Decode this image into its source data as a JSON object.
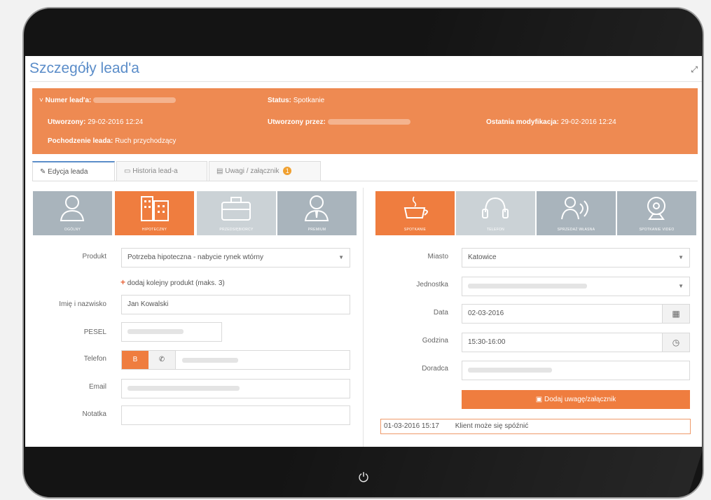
{
  "page": {
    "title": "Szczegóły lead'a"
  },
  "banner": {
    "lead_number_label": "Numer lead'a:",
    "status_label": "Status:",
    "status_value": "Spotkanie",
    "created_label": "Utworzony:",
    "created_value": "29-02-2016 12:24",
    "created_by_label": "Utworzony przez:",
    "modified_label": "Ostatnia modyfikacja:",
    "modified_value": "29-02-2016 12:24",
    "origin_label": "Pochodzenie leada:",
    "origin_value": "Ruch przychodzący"
  },
  "tabs": [
    {
      "label": "Edycja leada",
      "icon": "edit-icon"
    },
    {
      "label": "Historia lead-a",
      "icon": "history-icon"
    },
    {
      "label": "Uwagi / załącznik",
      "icon": "attachment-icon",
      "badge": "1"
    }
  ],
  "product_tiles": [
    {
      "label": "OGÓLNY",
      "icon": "person-icon",
      "state": "inactive"
    },
    {
      "label": "HIPOTECZNY",
      "icon": "building-icon",
      "state": "active"
    },
    {
      "label": "PRZEDSIĘBIORCY",
      "icon": "briefcase-icon",
      "state": "disabled"
    },
    {
      "label": "PREMIUM",
      "icon": "person-tie-icon",
      "state": "inactive"
    }
  ],
  "contact_tiles": [
    {
      "label": "SPOTKANIE",
      "icon": "coffee-icon",
      "state": "active"
    },
    {
      "label": "TELEFON",
      "icon": "headset-icon",
      "state": "disabled"
    },
    {
      "label": "SPRZEDAŻ WŁASNA",
      "icon": "handshake-icon",
      "state": "inactive"
    },
    {
      "label": "SPOTKANIE VIDEO",
      "icon": "webcam-icon",
      "state": "inactive"
    }
  ],
  "form": {
    "product_label": "Produkt",
    "product_value": "Potrzeba hipoteczna - nabycie rynek wtórny",
    "add_product": "dodaj kolejny produkt (maks. 3)",
    "name_label": "Imię i nazwisko",
    "name_value": "Jan Kowalski",
    "pesel_label": "PESEL",
    "phone_label": "Telefon",
    "phone_type_button": "B",
    "email_label": "Email",
    "note_label": "Notatka"
  },
  "meeting": {
    "city_label": "Miasto",
    "city_value": "Katowice",
    "unit_label": "Jednostka",
    "date_label": "Data",
    "date_value": "02-03-2016",
    "time_label": "Godzina",
    "time_value": "15:30-16:00",
    "advisor_label": "Doradca",
    "add_note_button": "Dodaj uwagę/załącznik",
    "note_entry_date": "01-03-2016 15:17",
    "note_entry_text": "Klient może się spóźnić"
  },
  "colors": {
    "accent_orange": "#ef7d3f",
    "banner_orange": "#ee8a52",
    "title_blue": "#5b8dc9",
    "tile_grey": "#a9b4bc"
  }
}
